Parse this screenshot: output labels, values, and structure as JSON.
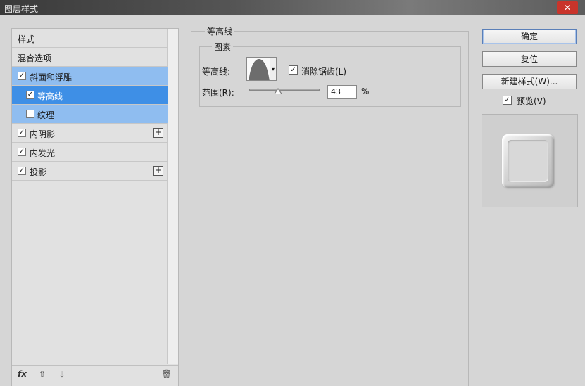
{
  "window": {
    "title": "图层样式",
    "close_label": "✕"
  },
  "sidebar": {
    "header": "样式",
    "blend_options": "混合选项",
    "items": [
      {
        "label": "斜面和浮雕",
        "checked": true
      },
      {
        "label": "等高线",
        "checked": true
      },
      {
        "label": "纹理",
        "checked": false
      },
      {
        "label": "内阴影",
        "checked": true
      },
      {
        "label": "内发光",
        "checked": true
      },
      {
        "label": "投影",
        "checked": true
      }
    ],
    "plus_label": "+",
    "bottom": {
      "fx": "fx",
      "up": "⇧",
      "down": "⇩",
      "trash": "🗑"
    }
  },
  "panel": {
    "group_title": "等高线",
    "sub_title": "图素",
    "contour_label": "等高线:",
    "antialias_label": "消除锯齿(L)",
    "antialias_checked": true,
    "range_label": "范围(R):",
    "range_value": "43",
    "range_unit": "%"
  },
  "buttons": {
    "ok": "确定",
    "reset": "复位",
    "new_style": "新建样式(W)...",
    "preview": "预览(V)",
    "preview_checked": true
  },
  "check_mark": "✓"
}
